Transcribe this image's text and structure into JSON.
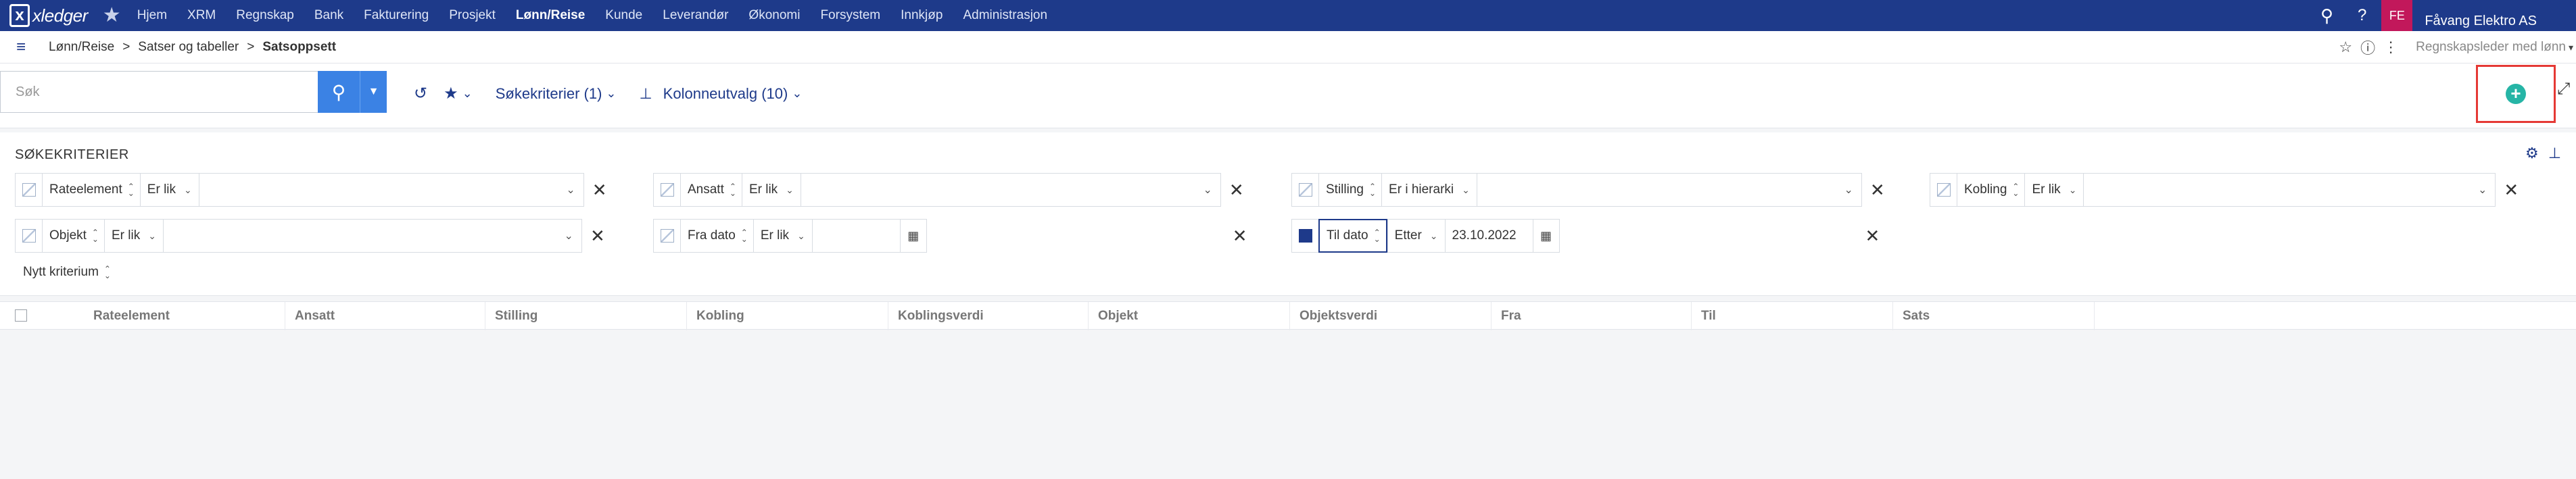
{
  "app": {
    "logo": "xledger",
    "logo_mark": "x"
  },
  "nav": {
    "items": [
      "Hjem",
      "XRM",
      "Regnskap",
      "Bank",
      "Fakturering",
      "Prosjekt",
      "Lønn/Reise",
      "Kunde",
      "Leverandør",
      "Økonomi",
      "Forsystem",
      "Innkjøp",
      "Administrasjon"
    ],
    "active": "Lønn/Reise"
  },
  "user": {
    "initials": "FE",
    "company": "Fåvang Elektro AS"
  },
  "breadcrumb": [
    "Lønn/Reise",
    "Satser og tabeller",
    "Satsoppsett"
  ],
  "breadcrumb_sep": ">",
  "role": "Regnskapsleder med lønn",
  "search": {
    "placeholder": "Søk",
    "value": ""
  },
  "toolbar": {
    "criteria_label": "Søkekriterier (1)",
    "columns_label": "Kolonneutvalg (10)"
  },
  "criteria": {
    "title": "SØKEKRITERIER",
    "row1": [
      {
        "name": "Rateelement",
        "op": "Er lik",
        "value": ""
      },
      {
        "name": "Ansatt",
        "op": "Er lik",
        "value": ""
      },
      {
        "name": "Stilling",
        "op": "Er i hierarki",
        "value": ""
      },
      {
        "name": "Kobling",
        "op": "Er lik",
        "value": ""
      }
    ],
    "row2": [
      {
        "name": "Objekt",
        "op": "Er lik",
        "value": ""
      },
      {
        "name": "Fra dato",
        "op": "Er lik",
        "value": ""
      },
      {
        "name": "Til dato",
        "op": "Etter",
        "value": "23.10.2022"
      }
    ],
    "new_criterion": "Nytt kriterium"
  },
  "table": {
    "columns": [
      "Rateelement",
      "Ansatt",
      "Stilling",
      "Kobling",
      "Koblingsverdi",
      "Objekt",
      "Objektsverdi",
      "Fra",
      "Til",
      "Sats"
    ]
  },
  "colors": {
    "nav_bg": "#1e3a8a",
    "accent": "#3b82e4",
    "add": "#26b5a6",
    "highlight": "#e53935"
  }
}
